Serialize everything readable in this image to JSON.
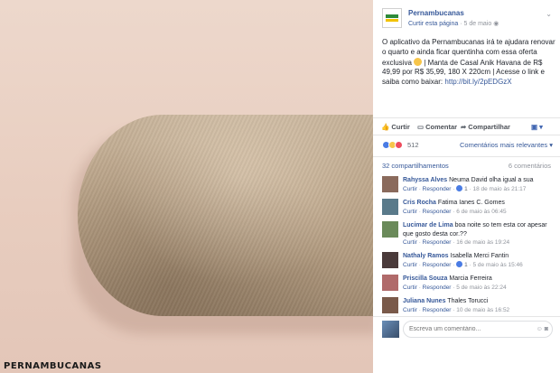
{
  "photo": {
    "brand_watermark": "PERNAMBUCANAS"
  },
  "post": {
    "page_name": "Pernambucanas",
    "follow_link": "Curtir esta página",
    "date": "5 de maio",
    "text_before_emoji": "O aplicativo da Pernambucanas irá te ajudara renovar o quarto e ainda ficar quentinha com essa oferta exclusiva",
    "text_after_emoji": "| Manta de Casal Anik Havana de R$ 49,99 por R$ 35,99, 180 X 220cm | Acesse o link e saiba como baixar:",
    "url": "http://bit.ly/2pEDGzX"
  },
  "actions": {
    "like": "Curtir",
    "comment": "Comentar",
    "share": "Compartilhar"
  },
  "reactions": {
    "count": "512",
    "relevance": "Comentários mais relevantes"
  },
  "stats": {
    "shares": "32 compartilhamentos",
    "comments": "6 comentários"
  },
  "comment_labels": {
    "like": "Curtir",
    "reply": "Responder"
  },
  "comments": [
    {
      "author": "Rahyssa Alves",
      "text": "Neuma David olha igual a sua",
      "likes": "1",
      "date": "18 de maio às 21:17",
      "avatar_color": "#8a6a5c"
    },
    {
      "author": "Cris Rocha",
      "text": "Fatima Ianes C. Gomes",
      "likes": "",
      "date": "6 de maio às 06:45",
      "avatar_color": "#5a7a8a"
    },
    {
      "author": "Lucimar de Lima",
      "text": "boa noite so tem esta cor apesar que gosto desta cor.??",
      "likes": "",
      "date": "16 de maio às 19:24",
      "avatar_color": "#6a8a5a"
    },
    {
      "author": "Nathaly Ramos",
      "text": "Isabella Merci Fantin",
      "likes": "1",
      "date": "5 de maio às 15:46",
      "avatar_color": "#4a3a3a"
    },
    {
      "author": "Priscilla Souza",
      "text": "Marcia Ferreira",
      "likes": "",
      "date": "5 de maio às 22:24",
      "avatar_color": "#b06a6a"
    },
    {
      "author": "Juliana Nunes",
      "text": "Thales Torucci",
      "likes": "",
      "date": "10 de maio às 16:52",
      "avatar_color": "#7a5a4a"
    }
  ],
  "composer": {
    "placeholder": "Escreva um comentário..."
  },
  "colors": {
    "link_blue": "#365899",
    "facebook_blue": "#4267b2",
    "blanket": "#bfa98e",
    "background_pink": "#e8cdbf"
  }
}
